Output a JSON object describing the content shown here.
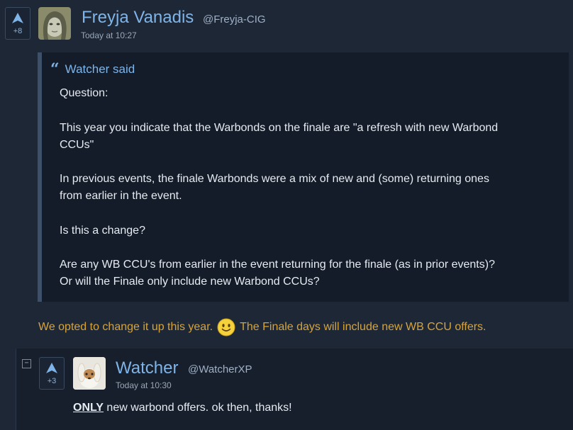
{
  "post": {
    "vote_count": "+8",
    "author": "Freyja Vanadis",
    "handle": "@Freyja-CIG",
    "time": "Today at 10:27",
    "quote": {
      "who": "Watcher said",
      "lines": [
        "Question:",
        "This year you indicate that the Warbonds on the finale are \"a refresh with new Warbond",
        "CCUs\"",
        "In previous events, the finale Warbonds were a mix of new and (some) returning ones",
        "from earlier in the event.",
        "Is this a change?",
        "Are any WB CCU's from earlier in the event returning for the finale (as in prior events)?",
        "Or will the Finale only include new Warbond CCUs?"
      ]
    },
    "reply_before": "We opted to change it up this year.",
    "reply_after": "The Finale days will include new WB CCU offers.",
    "colors": {
      "reply": "#d6a43a",
      "author": "#7fb4e8"
    }
  },
  "child": {
    "collapse_label": "−",
    "vote_count": "+3",
    "author": "Watcher",
    "handle": "@WatcherXP",
    "time": "Today at 10:30",
    "body_strong": "ONLY",
    "body_rest": " new warbond offers. ok then, thanks!"
  }
}
